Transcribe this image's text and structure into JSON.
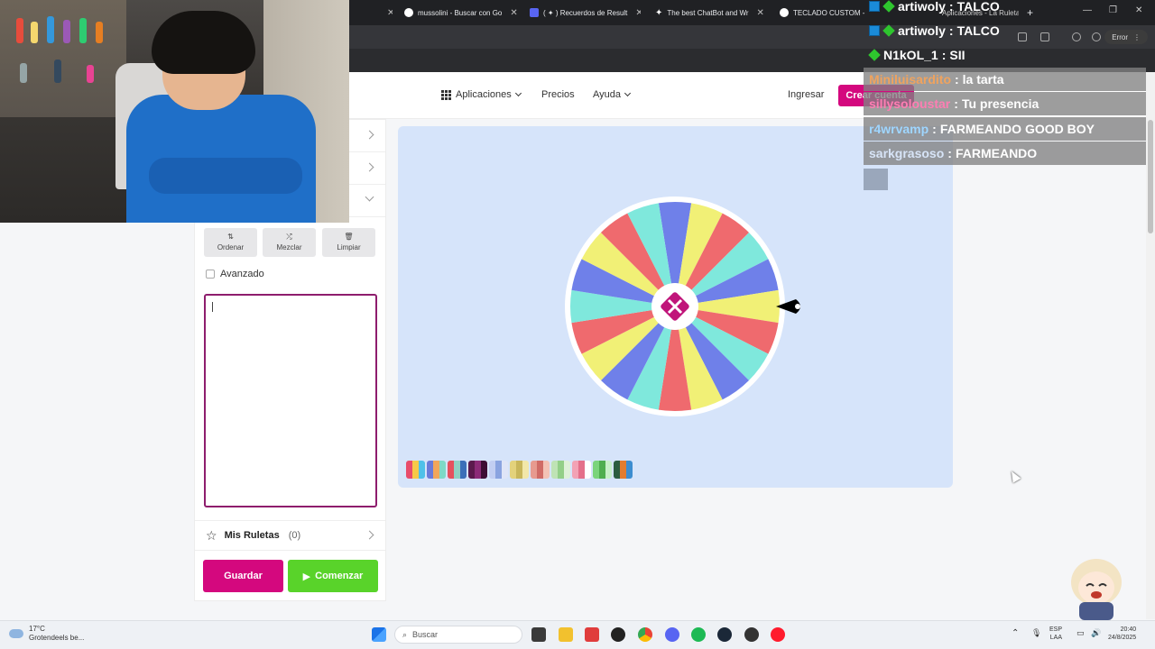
{
  "browser": {
    "tabs": [
      {
        "label": "mussolini - Buscar con Go",
        "favicon": "google-icon"
      },
      {
        "label": "( ✦ ) Recuerdos de Result",
        "favicon": "discord-icon"
      },
      {
        "label": "The best ChatBot and Wr",
        "favicon": "chatgpt-icon"
      },
      {
        "label": "TECLADO CUSTOM - B",
        "favicon": "google-icon"
      },
      {
        "label": "Aplicaciones - La Ruleta",
        "favicon": "wheel-icon"
      }
    ],
    "error_label": "Error"
  },
  "site_header": {
    "apps_label": "Aplicaciones",
    "prices_label": "Precios",
    "help_label": "Ayuda",
    "login_label": "Ingresar",
    "create_account_label": "Crear cuenta",
    "language": "ES"
  },
  "left_panel": {
    "tools": [
      {
        "label": "Ordenar",
        "icon": "⇅"
      },
      {
        "label": "Mezclar",
        "icon": "⤮"
      },
      {
        "label": "Limpiar",
        "icon": "🗑"
      }
    ],
    "advanced_label": "Avanzado",
    "my_roulettes_label": "Mis Ruletas",
    "my_roulettes_count": "(0)",
    "save_label": "Guardar",
    "start_label": "Comenzar"
  },
  "wheel": {
    "segment_colors": [
      "#6f80e9",
      "#f1f076",
      "#ef6a6e",
      "#7fe8dc"
    ],
    "segment_count": 20,
    "center_color": "#c0157a"
  },
  "palette_swatches": [
    [
      "#e84c6b",
      "#f7c948",
      "#4fc1e9"
    ],
    [
      "#6a7bd9",
      "#f2a65a",
      "#7ed9c6"
    ],
    [
      "#e5515d",
      "#8fd1c3",
      "#3b6fb8"
    ],
    [
      "#5b1a4d",
      "#8b2b77",
      "#3d0d34"
    ],
    [
      "#c2cef2",
      "#8aa3e0",
      "#dfe5f7"
    ],
    [
      "#e3d27b",
      "#c8b65a",
      "#f2e7a8"
    ],
    [
      "#e79a8f",
      "#d06b66",
      "#f3c2b5"
    ],
    [
      "#bfe3b5",
      "#93cf88",
      "#def1d8"
    ],
    [
      "#f2a2b5",
      "#e4708a",
      "#ffffff"
    ],
    [
      "#7bd47b",
      "#4fae4f",
      "#c8f0c8"
    ],
    [
      "#2b5d3f",
      "#e37c2f",
      "#3c8dd0"
    ]
  ],
  "chat": [
    {
      "user": "artiwoly",
      "user_color": "#ffffff",
      "message": "TALCO",
      "badges": [
        "badge-blue",
        "badge-green"
      ],
      "boxed": false
    },
    {
      "user": "artiwoly",
      "user_color": "#ffffff",
      "message": "TALCO",
      "badges": [
        "badge-blue",
        "badge-green"
      ],
      "boxed": false
    },
    {
      "user": "N1kOL_1",
      "user_color": "#ffffff",
      "message": "SII",
      "badges": [
        "badge-green"
      ],
      "boxed": false
    },
    {
      "user": "Miniluisardito",
      "user_color": "#f0a35e",
      "message": "la tarta",
      "badges": [],
      "boxed": true
    },
    {
      "user": "sillysoloustar",
      "user_color": "#ff7db3",
      "message": "Tu presencia",
      "badges": [],
      "boxed": true
    },
    {
      "user": "r4wrvamp",
      "user_color": "#9fd6ff",
      "message": "FARMEANDO GOOD BOY",
      "badges": [],
      "boxed": true
    },
    {
      "user": "sarkgrasoso",
      "user_color": "#d7e4f7",
      "message": "FARMEANDO",
      "badges": [],
      "boxed": true
    }
  ],
  "taskbar": {
    "weather_temp": "17°C",
    "weather_desc": "Grotendeels be...",
    "search_placeholder": "Buscar",
    "lang_top": "ESP",
    "lang_bottom": "LAA",
    "time": "20:40",
    "date": "24/8/2025"
  }
}
